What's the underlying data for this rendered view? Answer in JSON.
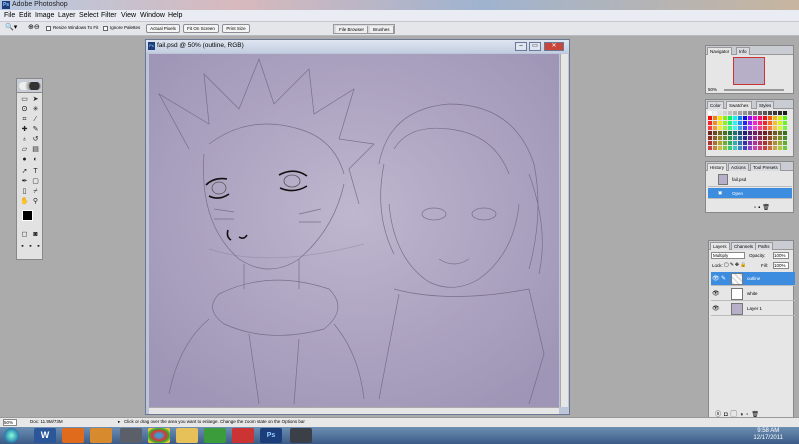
{
  "app": {
    "title": "Adobe Photoshop"
  },
  "menu": [
    "File",
    "Edit",
    "Image",
    "Layer",
    "Select",
    "Filter",
    "View",
    "Window",
    "Help"
  ],
  "options_bar": {
    "resize_windows_label": "Resize Windows To Fit",
    "ignore_palettes_label": "Ignore Palettes",
    "actual_pixels": "Actual Pixels",
    "fit_on_screen": "Fit On Screen",
    "print_size": "Print Size"
  },
  "palette_well": {
    "tabs": [
      "File Browser",
      "Brushes"
    ]
  },
  "document": {
    "title": "fail.psd @ 50% (outline, RGB)"
  },
  "navigator": {
    "tabs": [
      "Navigator",
      "Info"
    ],
    "zoom": "50%"
  },
  "color_panel": {
    "tabs": [
      "Color",
      "Swatches",
      "Styles"
    ]
  },
  "history": {
    "tabs": [
      "History",
      "Actions",
      "Tool Presets"
    ],
    "snapshot": "fail.psd",
    "steps": [
      "Open"
    ]
  },
  "layers": {
    "tabs": [
      "Layers",
      "Channels",
      "Paths"
    ],
    "blend_mode": "Multiply",
    "opacity_label": "Opacity:",
    "opacity": "100%",
    "lock_label": "Lock:",
    "fill_label": "Fill:",
    "fill": "100%",
    "items": [
      {
        "name": "outline",
        "selected": true
      },
      {
        "name": "white",
        "selected": false
      },
      {
        "name": "Layer 1",
        "selected": false
      }
    ]
  },
  "status": {
    "zoom": "50%",
    "doc": "Doc: 11.9M/73M",
    "hint": "Click or drag over the area you want to enlarge. Change the zoom state on the Options bar"
  },
  "taskbar": {
    "time": "9:58 AM",
    "date": "12/17/2011"
  },
  "colors": {
    "selection": "#3c8de0",
    "canvas": "#b7aec7"
  }
}
